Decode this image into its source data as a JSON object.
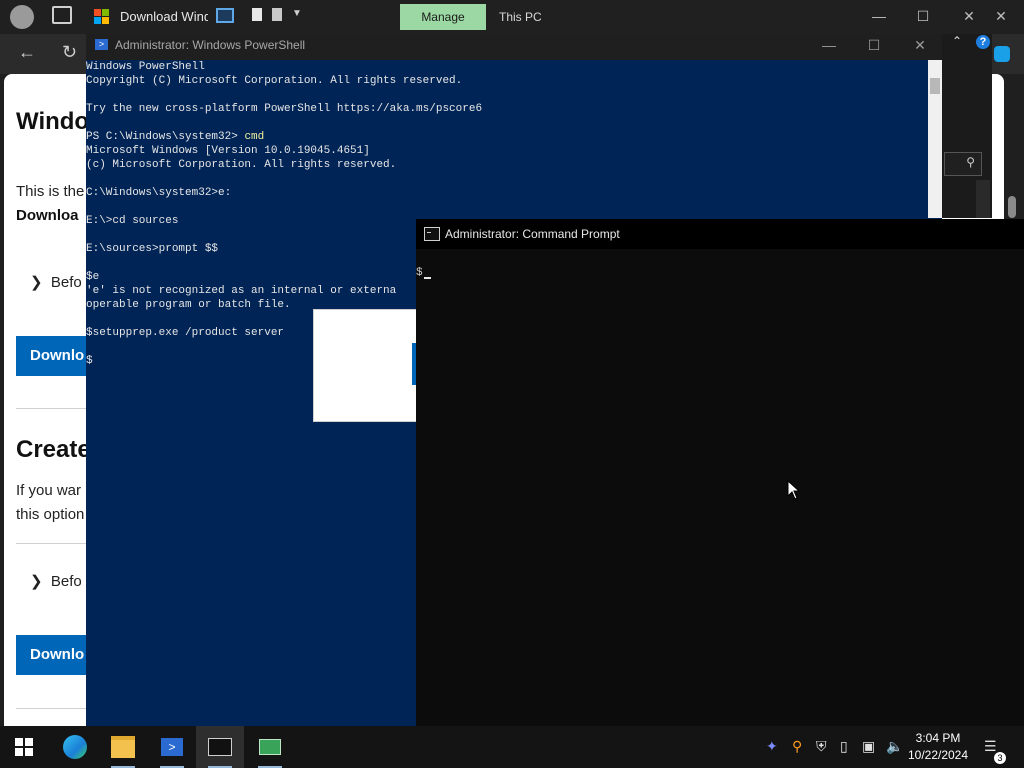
{
  "browser": {
    "tab_title": "Download Windows",
    "page": {
      "heading1": "Windo",
      "para1": "This is the",
      "para1_bold": "Downloa",
      "expander1": "Befo",
      "button1": "Downlo",
      "heading2": "Create",
      "para2_line1": "If you war",
      "para2_line2": "this option",
      "expander2": "Befo",
      "button2": "Downlo"
    }
  },
  "explorer": {
    "manage_tab": "Manage",
    "title": "This PC",
    "help_label": "?"
  },
  "powershell": {
    "title": "Administrator: Windows PowerShell",
    "lines_before": "Windows PowerShell\nCopyright (C) Microsoft Corporation. All rights reserved.\n\nTry the new cross-platform PowerShell https://aka.ms/pscore6\n\n",
    "prompt_ps": "PS C:\\Windows\\system32> ",
    "cmd_word": "cmd",
    "lines_after": "\nMicrosoft Windows [Version 10.0.19045.4651]\n(c) Microsoft Corporation. All rights reserved.\n\nC:\\Windows\\system32>e:\n\nE:\\>cd sources\n\nE:\\sources>prompt $$\n\n$e\n'e' is not recognized as an internal or externa\noperable program or batch file.\n\n$setupprep.exe /product server\n\n$"
  },
  "cmd": {
    "title": "Administrator: Command Prompt",
    "prompt": "$"
  },
  "taskbar": {
    "time": "3:04 PM",
    "date": "10/22/2024",
    "notification_count": "3",
    "apps": [
      "windows-start",
      "edge",
      "file-explorer",
      "powershell",
      "command-prompt",
      "setup"
    ]
  },
  "colors": {
    "powershell_bg": "#012456",
    "cmd_bg": "#0c0c0c",
    "manage_tab": "#9cd8a3",
    "ms_blue": "#0067b8"
  }
}
